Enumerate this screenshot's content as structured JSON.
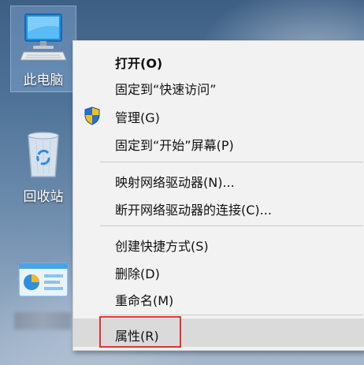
{
  "desktop": {
    "icons": [
      {
        "label": "此电脑"
      },
      {
        "label": "回收站"
      },
      {
        "label": ""
      }
    ]
  },
  "context_menu": {
    "items": [
      {
        "label": "打开(O)"
      },
      {
        "label": "固定到“快速访问”"
      },
      {
        "label": "管理(G)",
        "icon": "uac-shield-icon"
      },
      {
        "label": "固定到“开始”屏幕(P)"
      },
      {
        "label": "映射网络驱动器(N)..."
      },
      {
        "label": "断开网络驱动器的连接(C)..."
      },
      {
        "label": "创建快捷方式(S)"
      },
      {
        "label": "删除(D)"
      },
      {
        "label": "重命名(M)"
      },
      {
        "label": "属性(R)"
      }
    ]
  },
  "colors": {
    "menu_bg": "#f2f2f2",
    "hover_bg": "#dadada",
    "highlight_border": "#e3332f"
  }
}
